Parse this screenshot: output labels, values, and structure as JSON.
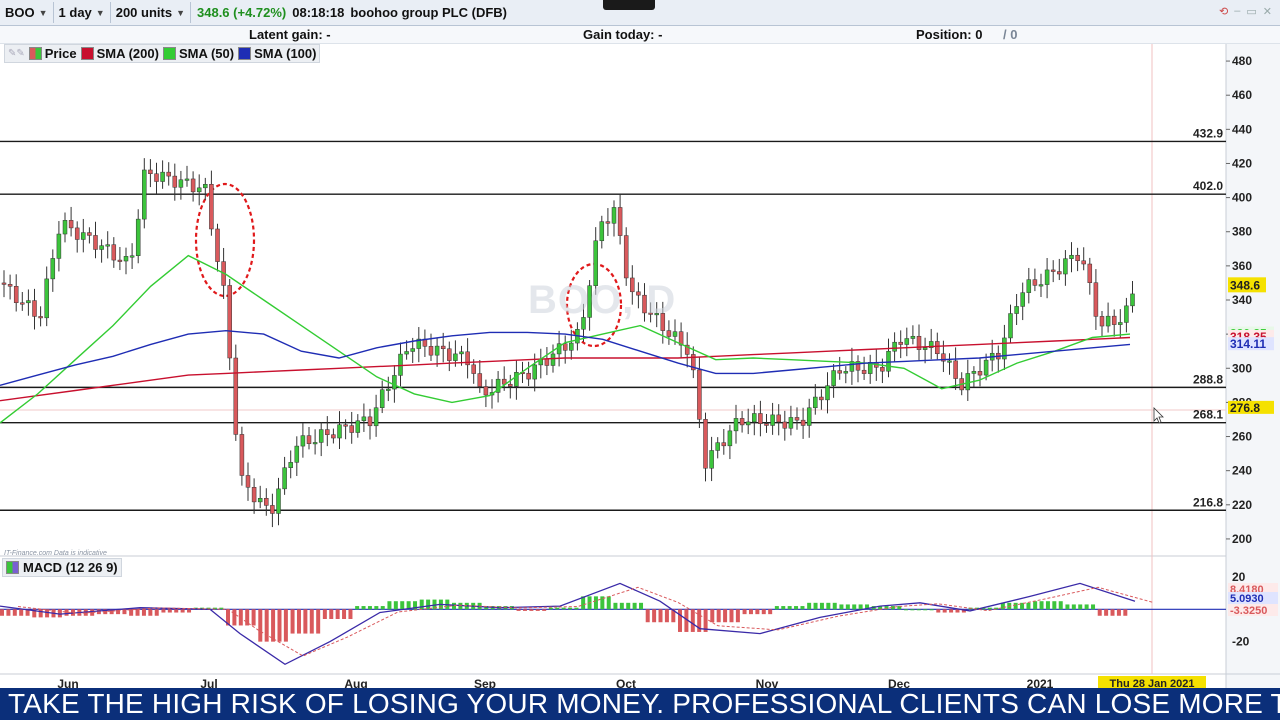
{
  "toolbar": {
    "symbol": "BOO",
    "interval": "1 day",
    "units": "200 units",
    "price_change": "348.6 (+4.72%)",
    "time": "08:18:18",
    "instrument_name": "boohoo group PLC (DFB)"
  },
  "info_bar": {
    "latent_gain": "Latent gain: -",
    "gain_today": "Gain today: -",
    "position": "Position: 0",
    "position_suffix": "/ 0"
  },
  "legend": {
    "price": "Price",
    "sma200": "SMA (200)",
    "sma50": "SMA (50)",
    "sma100": "SMA (100)"
  },
  "macd_legend": "MACD (12 26 9)",
  "watermark": "BOO, D",
  "disclaimer": "IT-Finance.com  Data is indicative",
  "ticker_text": "TAKE THE HIGH RISK OF LOSING YOUR MONEY. PROFESSIONAL CLIENTS CAN LOSE MORE TH",
  "colors": {
    "sma200": "#c8102e",
    "sma50": "#33cc33",
    "sma100": "#1f2db4",
    "bull": "#3cc43c",
    "bear": "#d9595c",
    "price_label": "#f5e100",
    "ticker_bg": "#0b2f7a"
  },
  "chart_data": [
    {
      "type": "candlestick",
      "title": "",
      "x_axis_labels": [
        "Jun",
        "Jul",
        "Aug",
        "Sep",
        "Oct",
        "Nov",
        "Dec",
        "2021"
      ],
      "current_date_label": "Thu 28 Jan 2021",
      "y_ticks": [
        200,
        220,
        240,
        260,
        280,
        300,
        320,
        340,
        360,
        380,
        400,
        420,
        440,
        460,
        480
      ],
      "ylim": [
        190,
        490
      ],
      "current_price": "348.6",
      "price_labels": [
        "320.35",
        "318.35",
        "314.11",
        "276.8"
      ],
      "horizontal_lines": [
        {
          "label": "432.9",
          "value": 432.9
        },
        {
          "label": "402.0",
          "value": 402.0
        },
        {
          "label": "288.8",
          "value": 288.8
        },
        {
          "label": "268.1",
          "value": 268.1
        },
        {
          "label": "216.8",
          "value": 216.8
        }
      ],
      "series": [
        {
          "name": "SMA (200)",
          "values": [
            281,
            284,
            287,
            290,
            293,
            296,
            297,
            298,
            299,
            300,
            301,
            302,
            303,
            304,
            305,
            306,
            306,
            306,
            306,
            307,
            308,
            309,
            310,
            311,
            312,
            313,
            314,
            315,
            316,
            317,
            318
          ]
        },
        {
          "name": "SMA (50)",
          "values": [
            268,
            285,
            305,
            325,
            348,
            366,
            355,
            340,
            325,
            310,
            295,
            285,
            280,
            284,
            300,
            315,
            320,
            325,
            315,
            305,
            306,
            305,
            304,
            303,
            300,
            288,
            293,
            303,
            310,
            318,
            320
          ]
        },
        {
          "name": "SMA (100)",
          "values": [
            290,
            296,
            302,
            307,
            314,
            320,
            322,
            320,
            310,
            306,
            312,
            316,
            319,
            321,
            321,
            320,
            317,
            310,
            303,
            297,
            297,
            299,
            301,
            303,
            304,
            305,
            306,
            308,
            310,
            312,
            314
          ]
        }
      ],
      "annotations": [
        "circle near early July candles",
        "circle near late September candles"
      ]
    },
    {
      "type": "macd",
      "title": "MACD (12 26 9)",
      "y_ticks": [
        20,
        -20
      ],
      "ylim": [
        -40,
        28
      ],
      "value_labels": [
        "8.4180",
        "5.0930",
        "-3.3250"
      ],
      "histogram": [
        -4,
        -5,
        -4,
        -3,
        -4,
        -2,
        1,
        -10,
        -20,
        -15,
        -6,
        2,
        5,
        6,
        4,
        2,
        -1,
        1,
        8,
        4,
        -8,
        -14,
        -8,
        -3,
        2,
        4,
        3,
        2,
        0,
        -2,
        1,
        4,
        5,
        3,
        -4
      ]
    }
  ]
}
